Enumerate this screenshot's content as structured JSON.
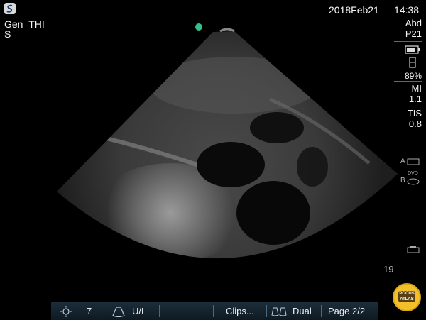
{
  "header": {
    "preset": "Gen",
    "mode": "THI",
    "sub": "S",
    "date": "2018Feb21",
    "time": "14:38"
  },
  "right_panel": {
    "exam": "Abd",
    "probe": "P21",
    "battery": "89%",
    "mi_label": "MI",
    "mi_value": "1.1",
    "tis_label": "TIS",
    "tis_value": "0.8",
    "a_label": "A",
    "b_label": "B",
    "dvd_label": "DVD"
  },
  "depth": "19",
  "bottom_bar": {
    "gain_value": "7",
    "orientation": "U/L",
    "clips_label": "Clips...",
    "dual_label": "Dual",
    "page_label": "Page 2/2"
  },
  "badge": {
    "line1": "POCUS",
    "line2": "ATLAS"
  },
  "colors": {
    "orientation_marker": "#33c08a",
    "bar_bg": "#1c2d3a",
    "badge": "#f4c02a"
  }
}
